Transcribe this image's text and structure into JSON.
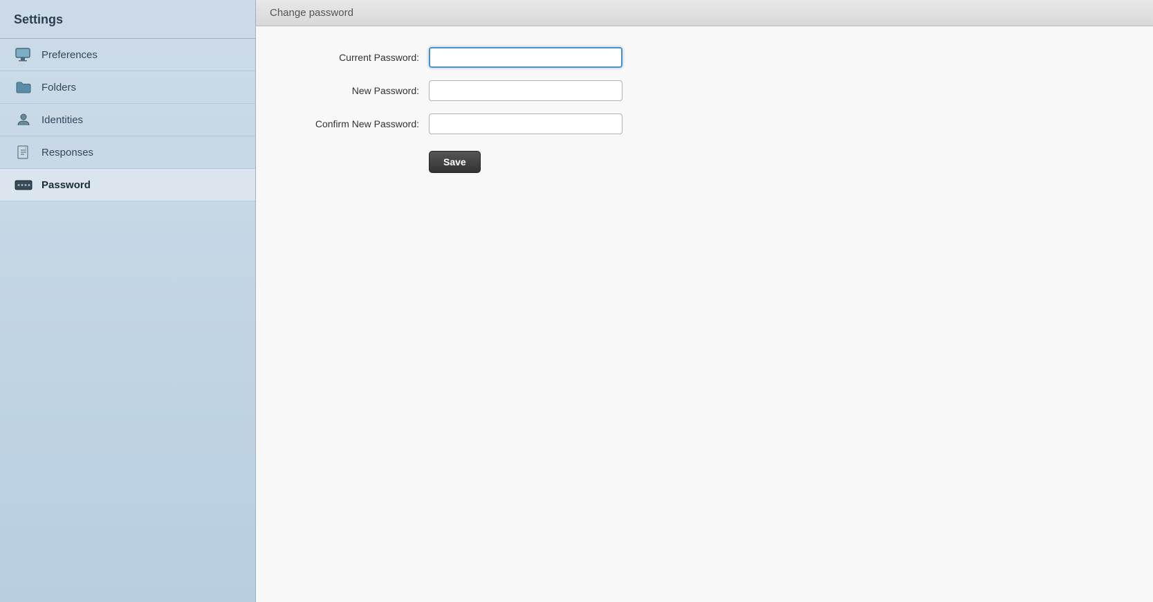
{
  "sidebar": {
    "title": "Settings",
    "items": [
      {
        "id": "preferences",
        "label": "Preferences",
        "icon": "monitor-icon",
        "active": false
      },
      {
        "id": "folders",
        "label": "Folders",
        "icon": "folder-icon",
        "active": false
      },
      {
        "id": "identities",
        "label": "Identities",
        "icon": "person-icon",
        "active": false
      },
      {
        "id": "responses",
        "label": "Responses",
        "icon": "doc-icon",
        "active": false
      },
      {
        "id": "password",
        "label": "Password",
        "icon": "password-icon",
        "active": true
      }
    ]
  },
  "main": {
    "header": "Change password",
    "form": {
      "current_password_label": "Current Password:",
      "new_password_label": "New Password:",
      "confirm_password_label": "Confirm New Password:",
      "save_button_label": "Save"
    }
  }
}
